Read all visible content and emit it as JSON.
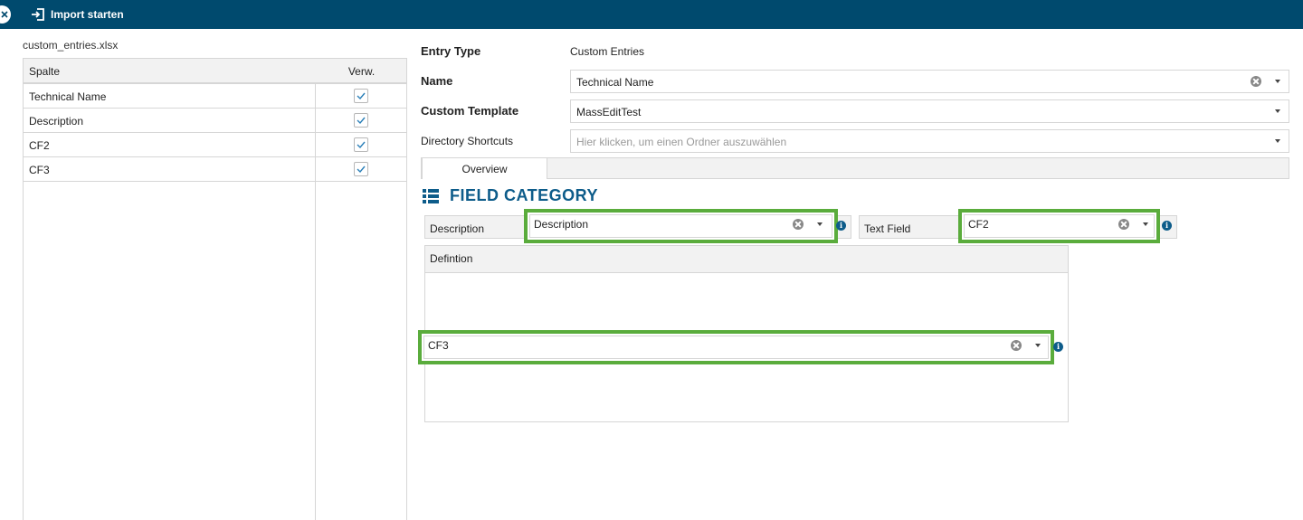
{
  "toolbar": {
    "import_label": "Import starten"
  },
  "file": {
    "name": "custom_entries.xlsx"
  },
  "columns_table": {
    "headers": [
      "Spalte",
      "Verw."
    ],
    "rows": [
      {
        "name": "Technical Name",
        "used": true
      },
      {
        "name": "Description",
        "used": true
      },
      {
        "name": "CF2",
        "used": true
      },
      {
        "name": "CF3",
        "used": true
      }
    ]
  },
  "form": {
    "entry_type": {
      "label": "Entry Type",
      "value": "Custom Entries"
    },
    "name": {
      "label": "Name",
      "value": "Technical Name"
    },
    "custom_template": {
      "label": "Custom Template",
      "value": "MassEditTest"
    },
    "directory_shortcuts": {
      "label": "Directory Shortcuts",
      "placeholder": "Hier klicken, um einen Ordner auszuwählen"
    }
  },
  "tabs": [
    "Overview"
  ],
  "field_category": {
    "title": "FIELD CATEGORY",
    "description_field": {
      "label": "Description",
      "value": "Description"
    },
    "text_field": {
      "label": "Text Field",
      "value": "CF2"
    },
    "definition": {
      "label": "Defintion",
      "value": "CF3"
    }
  },
  "colors": {
    "topbar": "#004a6e",
    "highlight": "#5aac3c",
    "accent": "#0d5c8a"
  },
  "icons": [
    "close-icon",
    "import-icon",
    "check-icon",
    "clear-icon",
    "dropdown-caret-icon",
    "list-icon",
    "info-icon"
  ]
}
